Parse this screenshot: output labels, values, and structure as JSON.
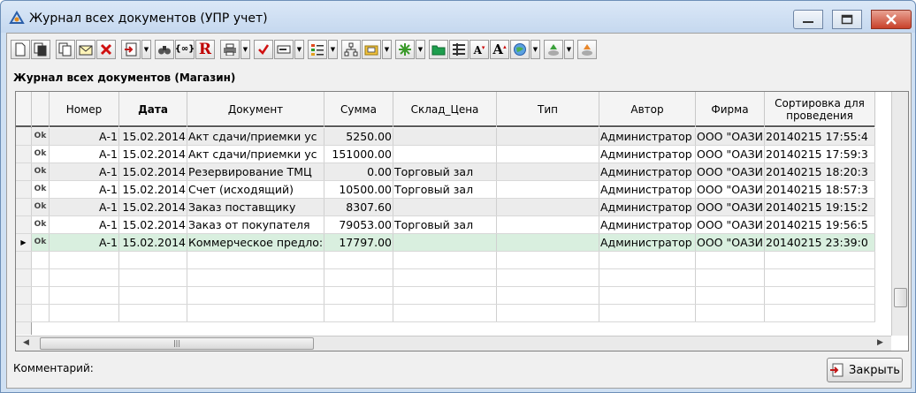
{
  "window": {
    "title": "Журнал всех документов (УПР учет)",
    "controls": {
      "minimize": "—",
      "maximize": "□",
      "close": "✕"
    }
  },
  "toolbar": {
    "icons": [
      "new-document-icon",
      "copy-document-icon",
      "duplicate-icon",
      "edit-envelope-icon",
      "delete-icon",
      "import-icon",
      "find-binoculars-icon",
      "code-brackets-icon",
      "report-r-icon",
      "print-icon",
      "check-icon",
      "form-icon",
      "list-icon",
      "tree-icon",
      "open-folder-icon",
      "cross-icon",
      "green-folder-icon",
      "columns-icon",
      "font-decrease-icon",
      "font-increase-icon",
      "globe-icon",
      "green-arrow-icon",
      "orange-arrow-icon"
    ]
  },
  "grid": {
    "title": "Журнал всех документов (Магазин)",
    "columns": [
      "",
      "",
      "Номер",
      "Дата",
      "Документ",
      "Сумма",
      "Склад_Цена",
      "Тип",
      "Автор",
      "Фирма",
      "Сортировка для проведения"
    ],
    "rows": [
      {
        "status": "Ok",
        "number": "А-1",
        "date": "15.02.2014",
        "document": "Акт сдачи/приемки ус",
        "sum": "5250.00",
        "warehouse": "",
        "type": "",
        "author": "Администратор",
        "firm": "ООО \"ОАЗИ",
        "sort": "20140215  17:55:4"
      },
      {
        "status": "Ok",
        "number": "А-1",
        "date": "15.02.2014",
        "document": "Акт сдачи/приемки ус",
        "sum": "151000.00",
        "warehouse": "",
        "type": "",
        "author": "Администратор",
        "firm": "ООО \"ОАЗИ",
        "sort": "20140215  17:59:3"
      },
      {
        "status": "Ok",
        "number": "А-1",
        "date": "15.02.2014",
        "document": "Резервирование ТМЦ",
        "sum": "0.00",
        "warehouse": "Торговый зал",
        "type": "",
        "author": "Администратор",
        "firm": "ООО \"ОАЗИ",
        "sort": "20140215  18:20:3"
      },
      {
        "status": "Ok",
        "number": "А-1",
        "date": "15.02.2014",
        "document": "Счет (исходящий)",
        "sum": "10500.00",
        "warehouse": "Торговый зал",
        "type": "",
        "author": "Администратор",
        "firm": "ООО \"ОАЗИ",
        "sort": "20140215  18:57:3"
      },
      {
        "status": "Ok",
        "number": "А-1",
        "date": "15.02.2014",
        "document": "Заказ поставщику",
        "sum": "8307.60",
        "warehouse": "",
        "type": "",
        "author": "Администратор",
        "firm": "ООО \"ОАЗИ",
        "sort": "20140215  19:15:2"
      },
      {
        "status": "Ok",
        "number": "А-1",
        "date": "15.02.2014",
        "document": "Заказ от покупателя",
        "sum": "79053.00",
        "warehouse": "Торговый зал",
        "type": "",
        "author": "Администратор",
        "firm": "ООО \"ОАЗИ",
        "sort": "20140215  19:56:5"
      },
      {
        "status": "Ok",
        "number": "А-1",
        "date": "15.02.2014",
        "document": "Коммерческое предло:",
        "sum": "17797.00",
        "warehouse": "",
        "type": "",
        "author": "Администратор",
        "firm": "ООО \"ОАЗИ",
        "sort": "20140215  23:39:0"
      }
    ],
    "selected_row_index": 6,
    "current_row_marker": "▶",
    "scroll_grip": "|||",
    "scroll_left": "◀",
    "scroll_right": "▶"
  },
  "footer": {
    "comment_label": "Комментарий:",
    "close_button": "Закрыть"
  },
  "colors": {
    "selected_row": "#d9efdf",
    "alt_row": "#ececec",
    "titlebar": "#c5d8ef",
    "close_red": "#c8412a"
  }
}
